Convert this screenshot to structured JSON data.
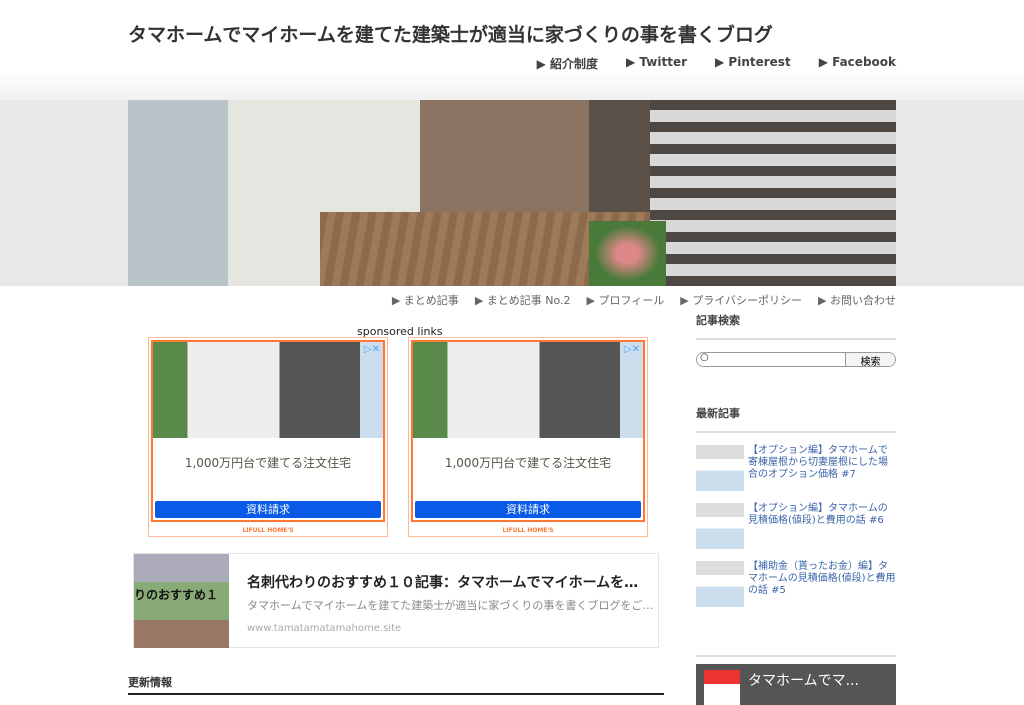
{
  "site": {
    "title": "タマホームでマイホームを建てた建築士が適当に家づくりの事を書くブログ"
  },
  "topnav": [
    "▶ 紹介制度",
    "▶ Twitter",
    "▶ Pinterest",
    "▶ Facebook"
  ],
  "subnav": [
    "▶ まとめ記事",
    "▶ まとめ記事 No.2",
    "▶ プロフィール",
    "▶ プライバシーポリシー",
    "▶ お問い合わせ"
  ],
  "ads": {
    "label": "sponsored links",
    "items": [
      {
        "text": "1,000万円台で建てる注文住宅",
        "button": "資料請求",
        "logo": "LIFULL HOME'S"
      },
      {
        "text": "1,000万円台で建てる注文住宅",
        "button": "資料請求",
        "logo": "LIFULL HOME'S"
      }
    ],
    "accent": "#ff7733",
    "button_color": "#0a5ae8"
  },
  "card": {
    "thumb_text": "りのおすすめ１",
    "title": "名刺代わりのおすすめ１０記事：タマホームでマイホームを…",
    "desc": "タマホームでマイホームを建てた建築士が適当に家づくりの事を書くブログをご…",
    "url": "www.tamatamatamahome.site"
  },
  "update": {
    "heading": "更新情報"
  },
  "sidebar": {
    "search_heading": "記事検索",
    "search_placeholder": "",
    "search_button": "検索",
    "recent_heading": "最新記事",
    "posts": [
      "【オプション編】タマホームで寄棟屋根から切妻屋根にした場合のオプション価格 #7",
      "【オプション編】タマホームの見積価格(値段)と費用の話 #6",
      "【補助金（貰ったお金）編】タマホームの見積価格(値段)と費用の話 #5"
    ],
    "widget_title": "タマホームでマ..."
  },
  "link_color": "#3a64a8"
}
